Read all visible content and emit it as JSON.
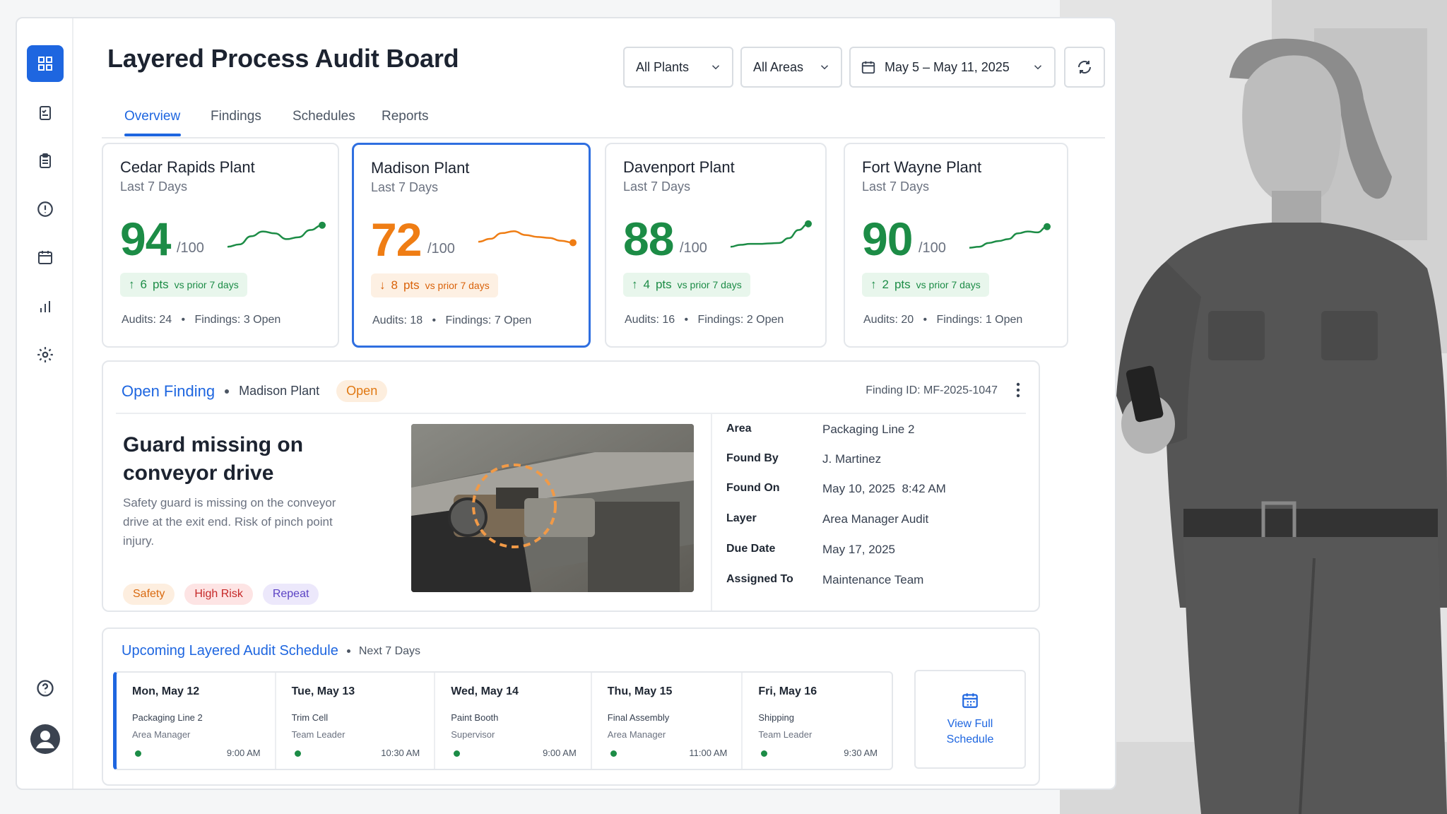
{
  "app": {
    "title": "Layered Process Audit Board"
  },
  "sidebar": {
    "icons": [
      "dashboard-icon",
      "checklist-icon",
      "clipboard-icon",
      "alert-icon",
      "calendar-icon",
      "bar-chart-icon",
      "gear-icon",
      "help-icon",
      "user-avatar-icon"
    ]
  },
  "tabs": [
    "Overview",
    "Findings",
    "Schedules",
    "Reports"
  ],
  "filters": {
    "plants": "All Plants",
    "areas": "All Areas",
    "date_range": "May 5 – May 11, 2025"
  },
  "plants": [
    {
      "name": "Cedar Rapids Plant",
      "period": "Last 7 Days",
      "score": "94",
      "out_of": "/100",
      "delta_value": "6",
      "delta_unit": "pts",
      "delta_note": "vs prior 7 days",
      "direction": "up",
      "audits_label": "Audits:",
      "audits": "24",
      "findings_label": "Findings:",
      "findings": "3 Open",
      "trend": [
        40,
        45,
        62,
        72,
        68,
        56,
        60,
        75,
        85
      ]
    },
    {
      "name": "Madison Plant",
      "period": "Last 7 Days",
      "score": "72",
      "out_of": "/100",
      "delta_value": "8",
      "delta_unit": "pts",
      "delta_note": "vs prior 7 days",
      "direction": "down",
      "audits_label": "Audits:",
      "audits": "18",
      "findings_label": "Findings:",
      "findings": "7 Open",
      "trend": [
        52,
        58,
        70,
        74,
        66,
        62,
        60,
        54,
        50
      ]
    },
    {
      "name": "Davenport Plant",
      "period": "Last 7 Days",
      "score": "88",
      "out_of": "/100",
      "delta_value": "4",
      "delta_unit": "pts",
      "delta_note": "vs prior 7 days",
      "direction": "up",
      "audits_label": "Audits:",
      "audits": "16",
      "findings_label": "Findings:",
      "findings": "2 Open",
      "trend": [
        40,
        44,
        46,
        46,
        47,
        48,
        58,
        75,
        88
      ]
    },
    {
      "name": "Fort Wayne Plant",
      "period": "Last 7 Days",
      "score": "90",
      "out_of": "/100",
      "delta_value": "2",
      "delta_unit": "pts",
      "delta_note": "vs prior 7 days",
      "direction": "up",
      "audits_label": "Audits:",
      "audits": "20",
      "findings_label": "Findings:",
      "findings": "1 Open",
      "trend": [
        38,
        40,
        48,
        52,
        56,
        68,
        72,
        70,
        82
      ]
    }
  ],
  "finding": {
    "label": "Open Finding",
    "plant": "Madison Plant",
    "status": "Open",
    "id_label": "Finding ID:",
    "id": "MF-2025-1047",
    "title": "Guard missing on conveyor drive",
    "description": "Safety guard is missing on the conveyor drive at the exit end. Risk of pinch point injury.",
    "tags": [
      "Safety",
      "High Risk",
      "Repeat"
    ],
    "details": [
      {
        "k": "Area",
        "v": "Packaging Line 2"
      },
      {
        "k": "Found By",
        "v": "J. Martinez"
      },
      {
        "k": "Found On",
        "v": "May 10, 2025  8:42 AM"
      },
      {
        "k": "Layer",
        "v": "Area Manager Audit"
      },
      {
        "k": "Due Date",
        "v": "May 17, 2025"
      },
      {
        "k": "Assigned To",
        "v": "Maintenance Team"
      }
    ]
  },
  "schedule": {
    "title": "Upcoming Layered Audit Schedule",
    "range": "Next 7 Days",
    "days": [
      {
        "day": "Mon, May 12",
        "area": "Packaging Line 2",
        "role": "Area Manager",
        "time": "9:00 AM"
      },
      {
        "day": "Tue, May 13",
        "area": "Trim Cell",
        "role": "Team Leader",
        "time": "10:30 AM"
      },
      {
        "day": "Wed, May 14",
        "area": "Paint Booth",
        "role": "Supervisor",
        "time": "9:00 AM"
      },
      {
        "day": "Thu, May 15",
        "area": "Final Assembly",
        "role": "Area Manager",
        "time": "11:00 AM"
      },
      {
        "day": "Fri, May 16",
        "area": "Shipping",
        "role": "Team Leader",
        "time": "9:30 AM"
      }
    ],
    "view_full": "View Full Schedule"
  },
  "colors": {
    "accent": "#1e66e0",
    "good": "#1c8c46",
    "warn": "#ef7d14"
  }
}
